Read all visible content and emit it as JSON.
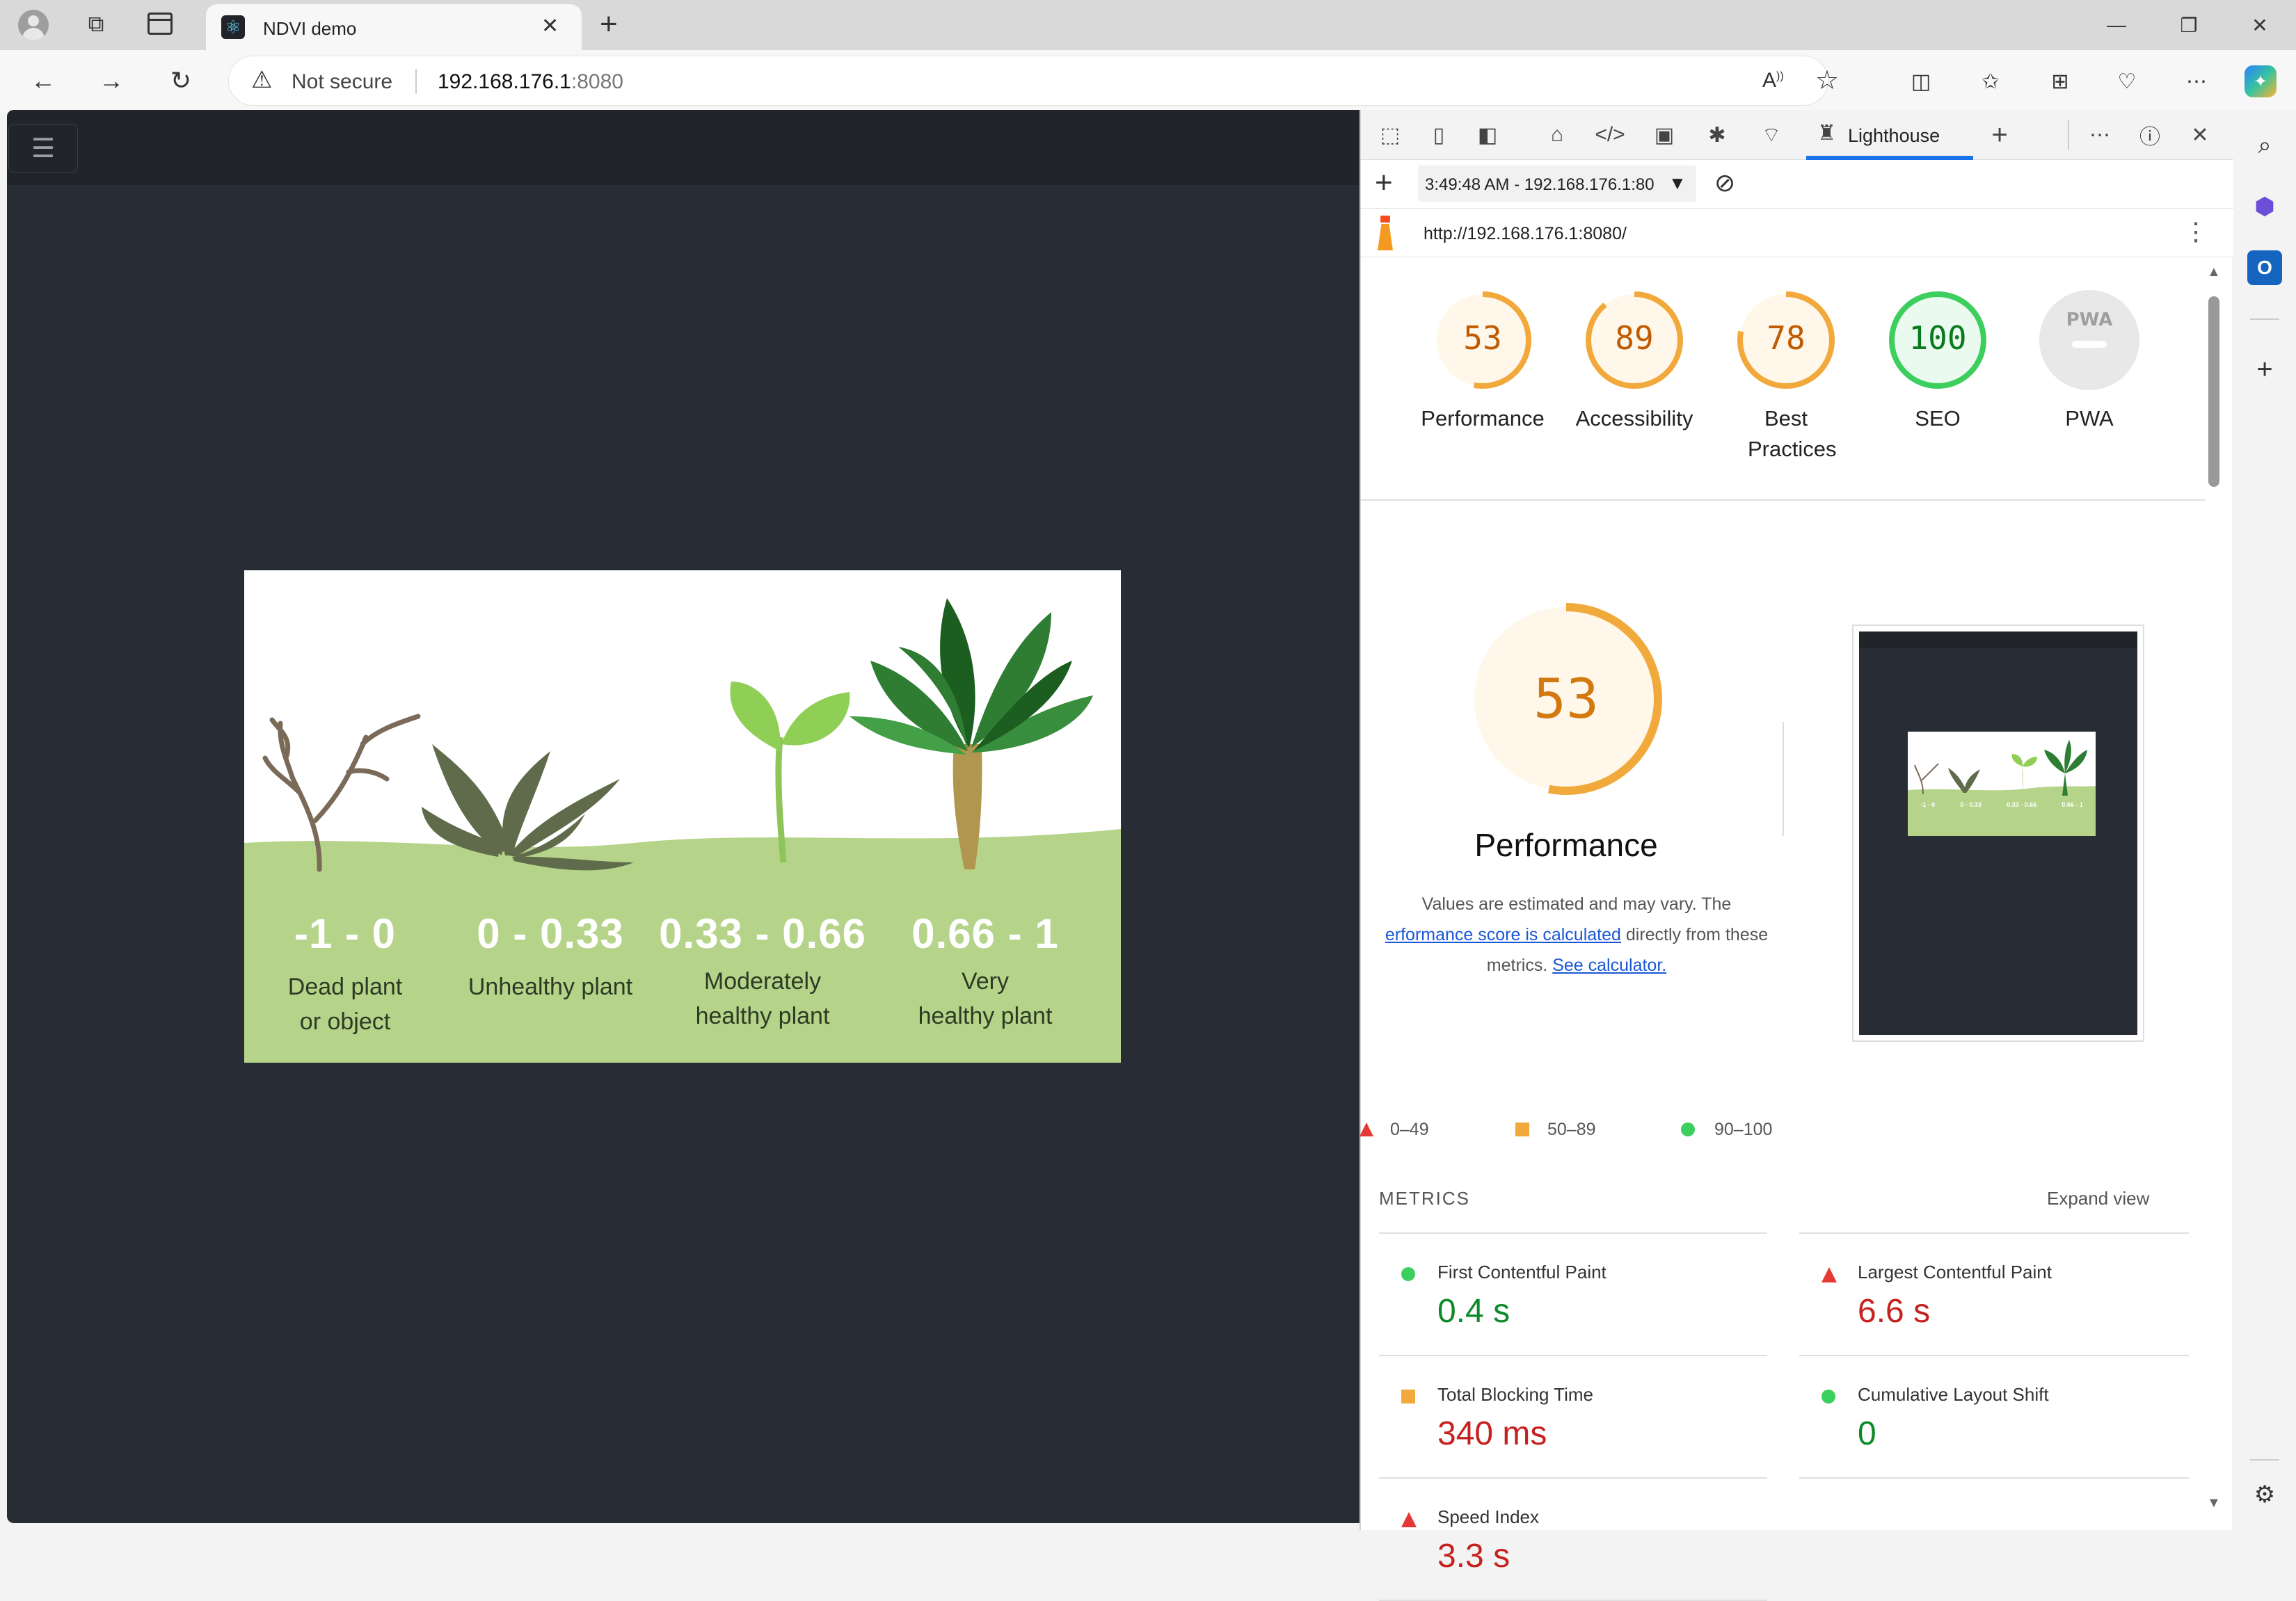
{
  "browser": {
    "tab_title": "NDVI demo",
    "security_label": "Not secure",
    "url_host": "192.168.176.1",
    "url_port": ":8080",
    "read_aloud_label": "A"
  },
  "ndvi_image": {
    "ranges": [
      {
        "value": "-1 - 0",
        "label_line1": "Dead plant",
        "label_line2": "or  object"
      },
      {
        "value": "0 - 0.33",
        "label_line1": "Unhealthy plant",
        "label_line2": ""
      },
      {
        "value": "0.33 - 0.66",
        "label_line1": "Moderately",
        "label_line2": "healthy plant"
      },
      {
        "value": "0.66 - 1",
        "label_line1": "Very",
        "label_line2": "healthy plant"
      }
    ]
  },
  "devtools": {
    "active_tab": "Lighthouse",
    "report_select": "3:49:48 AM - 192.168.176.1:80",
    "report_url": "http://192.168.176.1:8080/",
    "scores": [
      {
        "value": 53,
        "label": "Performance",
        "color": "#e67700"
      },
      {
        "value": 89,
        "label": "Accessibility",
        "color": "#e67700"
      },
      {
        "value": 78,
        "label": "Best Practices",
        "color": "#e67700"
      },
      {
        "value": 100,
        "label": "SEO",
        "color": "#0a8a0a"
      }
    ],
    "pwa_label": "PWA",
    "pwa_badge": "PWA",
    "perf_big_score": "53",
    "perf_title": "Performance",
    "perf_desc_1": "Values are estimated and may vary. The",
    "perf_desc_link": "erformance score is calculated",
    "perf_desc_2": " directly from these",
    "perf_desc_3": "metrics. ",
    "perf_desc_calc": "See calculator.",
    "legend": {
      "fail": "0–49",
      "average": "50–89",
      "pass": "90–100"
    },
    "metrics_header": "METRICS",
    "expand_view": "Expand view",
    "metrics": [
      {
        "name": "First Contentful Paint",
        "value": "0.4 s",
        "status": "pass"
      },
      {
        "name": "Largest Contentful Paint",
        "value": "6.6 s",
        "status": "fail"
      },
      {
        "name": "Total Blocking Time",
        "value": "340 ms",
        "status": "average"
      },
      {
        "name": "Cumulative Layout Shift",
        "value": "0",
        "status": "pass"
      },
      {
        "name": "Speed Index",
        "value": "3.3 s",
        "status": "fail"
      }
    ],
    "colors": {
      "pass": "#0c8a2a",
      "average": "#f0a030",
      "fail": "#c5221f",
      "link": "#1a57d6"
    }
  },
  "thumbnail": {
    "values": [
      "-1 - 0",
      "0 - 0.33",
      "0.33 - 0.66",
      "0.66 - 1"
    ]
  }
}
